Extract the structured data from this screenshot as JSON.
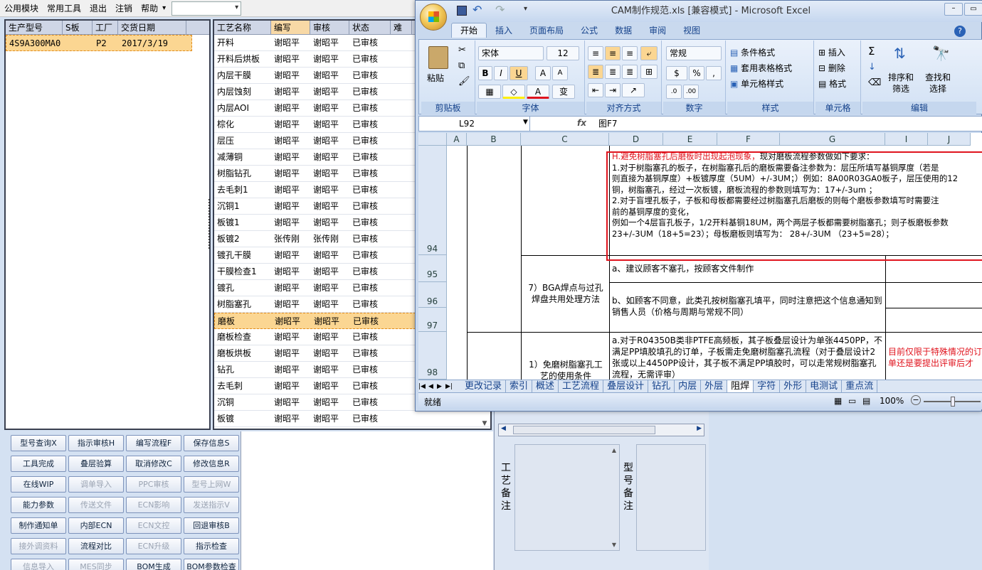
{
  "menubar": {
    "items": [
      "公用模块",
      "常用工具",
      "退出",
      "注销",
      "帮助"
    ],
    "help_arrow": "▾"
  },
  "order_grid": {
    "headers": [
      "生产型号",
      "S板",
      "工厂",
      "交货日期"
    ],
    "rows": [
      {
        "model": "4S9A300MA0",
        "sboard": "",
        "factory": "P2",
        "date": "2017/3/19"
      }
    ]
  },
  "process_grid": {
    "headers": [
      "工艺名称",
      "编写",
      "审核",
      "状态",
      "难"
    ],
    "rows": [
      {
        "name": "开料",
        "writer": "谢昭平",
        "reviewer": "谢昭平",
        "status": "已审核"
      },
      {
        "name": "开料后烘板",
        "writer": "谢昭平",
        "reviewer": "谢昭平",
        "status": "已审核"
      },
      {
        "name": "内层干膜",
        "writer": "谢昭平",
        "reviewer": "谢昭平",
        "status": "已审核"
      },
      {
        "name": "内层蚀刻",
        "writer": "谢昭平",
        "reviewer": "谢昭平",
        "status": "已审核"
      },
      {
        "name": "内层AOI",
        "writer": "谢昭平",
        "reviewer": "谢昭平",
        "status": "已审核"
      },
      {
        "name": "棕化",
        "writer": "谢昭平",
        "reviewer": "谢昭平",
        "status": "已审核"
      },
      {
        "name": "层压",
        "writer": "谢昭平",
        "reviewer": "谢昭平",
        "status": "已审核"
      },
      {
        "name": "减薄铜",
        "writer": "谢昭平",
        "reviewer": "谢昭平",
        "status": "已审核"
      },
      {
        "name": "树脂钻孔",
        "writer": "谢昭平",
        "reviewer": "谢昭平",
        "status": "已审核"
      },
      {
        "name": "去毛刺1",
        "writer": "谢昭平",
        "reviewer": "谢昭平",
        "status": "已审核"
      },
      {
        "name": "沉铜1",
        "writer": "谢昭平",
        "reviewer": "谢昭平",
        "status": "已审核"
      },
      {
        "name": "板镀1",
        "writer": "谢昭平",
        "reviewer": "谢昭平",
        "status": "已审核"
      },
      {
        "name": "板镀2",
        "writer": "张传刚",
        "reviewer": "张传刚",
        "status": "已审核"
      },
      {
        "name": "镀孔干膜",
        "writer": "谢昭平",
        "reviewer": "谢昭平",
        "status": "已审核"
      },
      {
        "name": "干膜检查1",
        "writer": "谢昭平",
        "reviewer": "谢昭平",
        "status": "已审核"
      },
      {
        "name": "镀孔",
        "writer": "谢昭平",
        "reviewer": "谢昭平",
        "status": "已审核"
      },
      {
        "name": "树脂塞孔",
        "writer": "谢昭平",
        "reviewer": "谢昭平",
        "status": "已审核"
      },
      {
        "name": "磨板",
        "writer": "谢昭平",
        "reviewer": "谢昭平",
        "status": "已审核"
      },
      {
        "name": "磨板检查",
        "writer": "谢昭平",
        "reviewer": "谢昭平",
        "status": "已审核"
      },
      {
        "name": "磨板烘板",
        "writer": "谢昭平",
        "reviewer": "谢昭平",
        "status": "已审核"
      },
      {
        "name": "钻孔",
        "writer": "谢昭平",
        "reviewer": "谢昭平",
        "status": "已审核"
      },
      {
        "name": "去毛刺",
        "writer": "谢昭平",
        "reviewer": "谢昭平",
        "status": "已审核"
      },
      {
        "name": "沉铜",
        "writer": "谢昭平",
        "reviewer": "谢昭平",
        "status": "已审核"
      },
      {
        "name": "板镀",
        "writer": "谢昭平",
        "reviewer": "谢昭平",
        "status": "已审核"
      }
    ]
  },
  "buttons": {
    "col1": [
      "型号查询X",
      "工具完成",
      "在线WIP",
      "能力参数",
      "制作通知单",
      "接外调资料",
      "信息导入"
    ],
    "col2": [
      "指示审核H",
      "叠层验算",
      "调单导入",
      "传送文件",
      "内部ECN",
      "流程对比",
      "MES同步"
    ],
    "col3": [
      "编写流程F",
      "取消修改C",
      "PPC审核",
      "ECN影响",
      "ECN文控",
      "ECN升级",
      "BOM生成"
    ],
    "col4": [
      "保存信息S",
      "修改信息R",
      "型号上网W",
      "发送指示V",
      "回退审核B",
      "指示检查",
      "BOM参数检查"
    ]
  },
  "remarks": {
    "craft_label": "工艺备注",
    "model_label": "型号备注"
  },
  "excel": {
    "title": "CAM制作规范.xls  [兼容模式] - Microsoft Excel",
    "ribbon_tabs": [
      "开始",
      "插入",
      "页面布局",
      "公式",
      "数据",
      "审阅",
      "视图"
    ],
    "groups": {
      "clipboard": "剪贴板",
      "font": "字体",
      "align": "对齐方式",
      "number": "数字",
      "style": "样式",
      "cells": "单元格",
      "edit": "编辑"
    },
    "paste": "粘贴",
    "font_name": "宋体",
    "font_size": "12",
    "number_format": "常规",
    "style_items": [
      "条件格式",
      "套用表格格式",
      "单元格样式"
    ],
    "cell_items": [
      "插入",
      "删除",
      "格式"
    ],
    "edit_items": [
      "排序和筛选",
      "查找和选择"
    ],
    "name_box": "L92",
    "fx": "fx",
    "formula": "图F7",
    "columns": [
      "A",
      "B",
      "C",
      "D",
      "E",
      "F",
      "G",
      "I",
      "J"
    ],
    "rows": {
      "r94": "94",
      "r95": "95",
      "r96": "96",
      "r97": "97",
      "r98": "98"
    },
    "cells": {
      "d94_title": "H.避免树脂塞孔后磨板时出现起泡现象，",
      "d94_title2": "现对磨板流程参数做如下要求：",
      "d94_lines": [
        "1.对于树脂塞孔的板子，在树脂塞孔后的磨板需要备注参数为：层压所填写基铜厚度（若是",
        "则直接为基铜厚度）+板镀厚度（5UM）+/-3UM；）例如：8A00R03GA0板子，层压使用的12",
        "铜，树脂塞孔，经过一次板镀，磨板流程的参数则填写为：17+/-3um ；",
        "2.对于盲埋孔板子，子板和母板都需要经过树脂塞孔后磨板的则每个磨板参数填写时需要注",
        "前的基铜厚度的变化，",
        "例如一个4层盲孔板子，1/2开料基铜18UM，两个两层子板都需要树脂塞孔；则子板磨板参数",
        "23+/-3UM（18+5=23）；母板磨板则填写为： 28+/-3UM （23+5=28）；"
      ],
      "c95": "7）BGA焊点与过孔焊盘共用处理方法",
      "d95": "a、建议顾客不塞孔，按顾客文件制作",
      "d96": "b、如顾客不同意，此类孔按树脂塞孔填平，同时注意把这个信息通知到销售人员（价格与周期与常规不同）",
      "c98": "1）免磨树脂塞孔工艺的使用条件",
      "d98": "a.对于R04350B类非PTFE高频板，其子板叠层设计为单张4450PP，不满足PP填胶填孔的订单，子板需走免磨树脂塞孔流程（对于叠层设计2张或以上4450PP设计，其子板不满足PP填胶时，可以走常规树脂塞孔流程，无需评审）",
      "g98": "目前仅限于特殊情况的订单还是要提出评审后才"
    },
    "sheet_tabs": [
      "更改记录",
      "索引",
      "概述",
      "工艺流程",
      "叠层设计",
      "钻孔",
      "内层",
      "外层",
      "阻焊",
      "字符",
      "外形",
      "电测试",
      "重点流"
    ],
    "active_sheet": "阻焊",
    "status": "就绪",
    "zoom": "100%"
  },
  "colors": {
    "accent": "#15428b",
    "selected_row": "#fbd692",
    "highlight_red": "#e0141e"
  }
}
